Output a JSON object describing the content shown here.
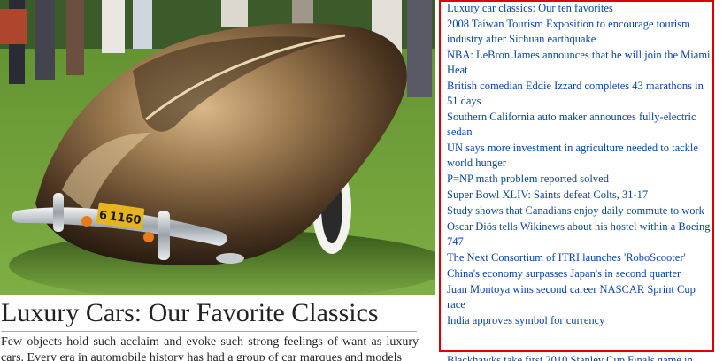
{
  "article": {
    "title": "Luxury Cars: Our Favorite Classics",
    "body": "Few objects hold such acclaim and evoke such strong feelings of want as luxury cars. Every era in automobile history has had a group of car marques and models"
  },
  "photo": {
    "plate_text": "6 1160"
  },
  "news": {
    "border_color": "#e00000",
    "link_color": "#0645ad",
    "items": [
      "Luxury car classics: Our ten favorites",
      "2008 Taiwan Tourism Exposition to encourage tourism industry after Sichuan earthquake",
      "NBA: LeBron James announces that he will join the Miami Heat",
      "British comedian Eddie Izzard completes 43 marathons in 51 days",
      "Southern California auto maker announces fully-electric sedan",
      "UN says more investment in agriculture needed to tackle world hunger",
      "P=NP math problem reported solved",
      "Super Bowl XLIV: Saints defeat Colts, 31-17",
      "Study shows that Canadians enjoy daily commute to work",
      "Oscar Diös tells Wikinews about his hostel within a Boeing 747",
      "The Next Consortium of ITRI launches 'RoboScooter'",
      "China's economy surpasses Japan's in second quarter",
      "Juan Montoya wins second career NASCAR Sprint Cup race",
      "India approves symbol for currency"
    ],
    "overflow_item": "Blackhawks take first 2010 Stanley Cup Finals game in"
  }
}
